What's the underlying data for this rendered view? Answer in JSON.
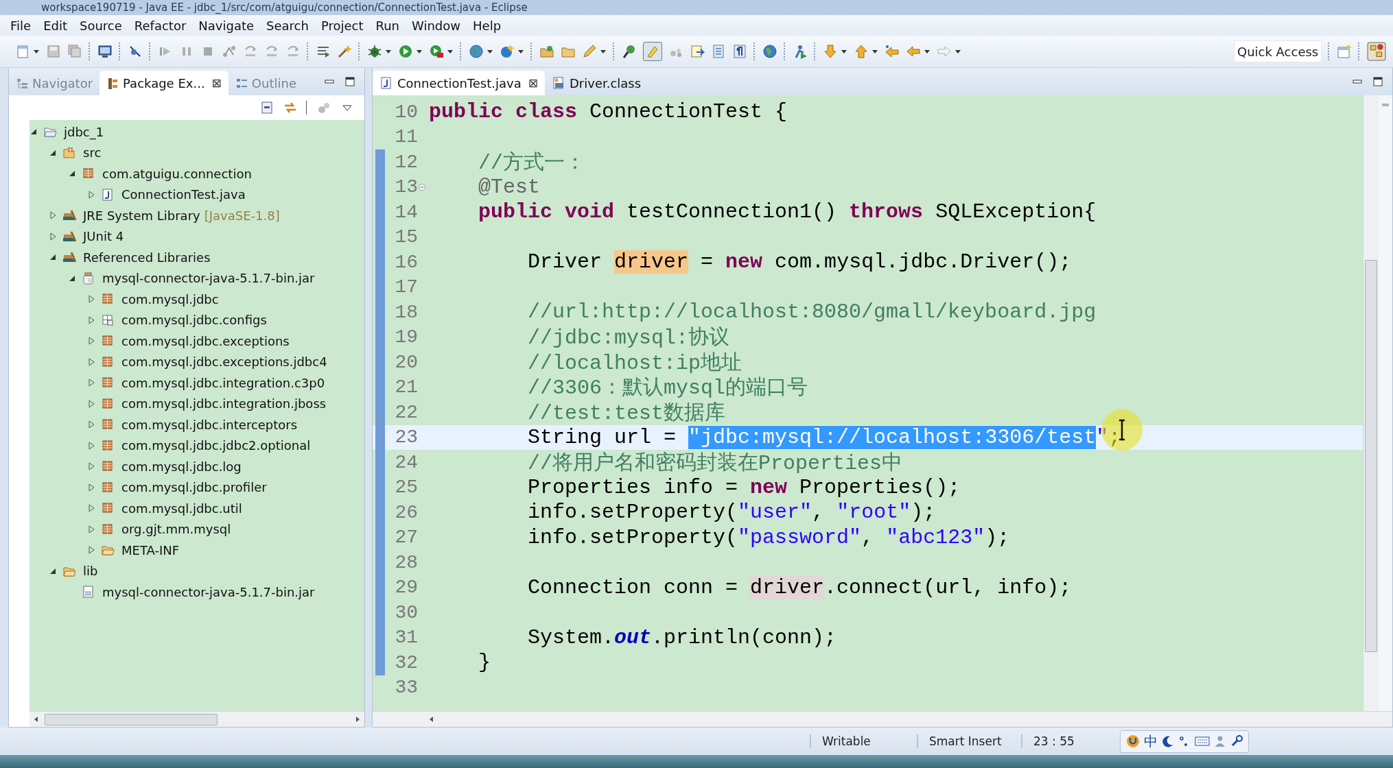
{
  "window": {
    "title": "workspace190719 - Java EE - jdbc_1/src/com/atguigu/connection/ConnectionTest.java - Eclipse"
  },
  "menu": [
    "File",
    "Edit",
    "Source",
    "Refactor",
    "Navigate",
    "Search",
    "Project",
    "Run",
    "Window",
    "Help"
  ],
  "quick_access": {
    "placeholder": "Quick Access"
  },
  "side_tabs": [
    {
      "label": "Navigator",
      "selected": false
    },
    {
      "label": "Package Ex...",
      "selected": true,
      "close": "⊠"
    },
    {
      "label": "Outline",
      "selected": false
    }
  ],
  "tree": [
    {
      "kind": "project",
      "label": "jdbc_1",
      "expanded": true,
      "children": [
        {
          "kind": "source-folder",
          "label": "src",
          "expanded": true,
          "children": [
            {
              "kind": "package",
              "label": "com.atguigu.connection",
              "expanded": true,
              "children": [
                {
                  "kind": "java-file",
                  "label": "ConnectionTest.java",
                  "expanded": false
                }
              ]
            }
          ]
        },
        {
          "kind": "library",
          "label": "JRE System Library",
          "decoration": "[JavaSE-1.8]",
          "expanded": false
        },
        {
          "kind": "library",
          "label": "JUnit 4",
          "expanded": false
        },
        {
          "kind": "library",
          "label": "Referenced Libraries",
          "expanded": true,
          "children": [
            {
              "kind": "jar",
              "label": "mysql-connector-java-5.1.7-bin.jar",
              "expanded": true,
              "children": [
                {
                  "kind": "package",
                  "label": "com.mysql.jdbc",
                  "expanded": false
                },
                {
                  "kind": "resource-package",
                  "label": "com.mysql.jdbc.configs",
                  "expanded": false
                },
                {
                  "kind": "package",
                  "label": "com.mysql.jdbc.exceptions",
                  "expanded": false
                },
                {
                  "kind": "package",
                  "label": "com.mysql.jdbc.exceptions.jdbc4",
                  "expanded": false
                },
                {
                  "kind": "package",
                  "label": "com.mysql.jdbc.integration.c3p0",
                  "expanded": false
                },
                {
                  "kind": "package",
                  "label": "com.mysql.jdbc.integration.jboss",
                  "expanded": false
                },
                {
                  "kind": "package",
                  "label": "com.mysql.jdbc.interceptors",
                  "expanded": false
                },
                {
                  "kind": "package",
                  "label": "com.mysql.jdbc.jdbc2.optional",
                  "expanded": false
                },
                {
                  "kind": "package",
                  "label": "com.mysql.jdbc.log",
                  "expanded": false
                },
                {
                  "kind": "package",
                  "label": "com.mysql.jdbc.profiler",
                  "expanded": false
                },
                {
                  "kind": "package",
                  "label": "com.mysql.jdbc.util",
                  "expanded": false
                },
                {
                  "kind": "package",
                  "label": "org.gjt.mm.mysql",
                  "expanded": false
                },
                {
                  "kind": "folder",
                  "label": "META-INF",
                  "expanded": false
                }
              ]
            }
          ]
        },
        {
          "kind": "folder",
          "label": "lib",
          "expanded": true,
          "children": [
            {
              "kind": "jar-file",
              "label": "mysql-connector-java-5.1.7-bin.jar"
            }
          ]
        }
      ]
    }
  ],
  "editor_tabs": [
    {
      "kind": "java",
      "label": "ConnectionTest.java",
      "selected": true,
      "close": "⊠"
    },
    {
      "kind": "class",
      "label": "Driver.class",
      "selected": false
    }
  ],
  "code": [
    {
      "number": "10",
      "changed": false,
      "current": false,
      "fold": false,
      "kind": "class",
      "segments": [
        {
          "kind": "keyword",
          "text": "public class"
        },
        {
          "kind": "plain",
          "text": " ConnectionTest {"
        }
      ]
    },
    {
      "number": "11",
      "changed": false,
      "current": false,
      "fold": false
    },
    {
      "number": "12",
      "changed": true,
      "current": false,
      "fold": false,
      "kind": "member",
      "segments": [
        {
          "kind": "comment",
          "text": "//方式一："
        }
      ]
    },
    {
      "number": "13",
      "changed": true,
      "current": false,
      "fold": true,
      "kind": "member",
      "segments": [
        {
          "kind": "annotation",
          "text": "@Test"
        }
      ]
    },
    {
      "number": "14",
      "changed": true,
      "current": false,
      "fold": false,
      "kind": "member",
      "segments": [
        {
          "kind": "keyword",
          "text": "public void"
        },
        {
          "kind": "plain",
          "text": " testConnection1() "
        },
        {
          "kind": "keyword",
          "text": "throws"
        },
        {
          "kind": "plain",
          "text": " SQLException{"
        }
      ]
    },
    {
      "number": "15",
      "changed": true,
      "current": false,
      "fold": false
    },
    {
      "number": "16",
      "changed": true,
      "current": false,
      "fold": false,
      "kind": "statement",
      "segments": [
        {
          "kind": "plain",
          "text": "Driver "
        },
        {
          "kind": "write-occurrence",
          "text": "driver"
        },
        {
          "kind": "plain",
          "text": " = "
        },
        {
          "kind": "keyword",
          "text": "new"
        },
        {
          "kind": "plain",
          "text": " com.mysql.jdbc.Driver();"
        }
      ]
    },
    {
      "number": "17",
      "changed": true,
      "current": false,
      "fold": false
    },
    {
      "number": "18",
      "changed": true,
      "current": false,
      "fold": false,
      "kind": "statement",
      "segments": [
        {
          "kind": "comment",
          "text": "//url:http://localhost:8080/gmall/keyboard.jpg"
        }
      ]
    },
    {
      "number": "19",
      "changed": true,
      "current": false,
      "fold": false,
      "kind": "statement",
      "segments": [
        {
          "kind": "comment",
          "text": "//jdbc:mysql:协议"
        }
      ]
    },
    {
      "number": "20",
      "changed": true,
      "current": false,
      "fold": false,
      "kind": "statement",
      "segments": [
        {
          "kind": "comment",
          "text": "//localhost:ip地址"
        }
      ]
    },
    {
      "number": "21",
      "changed": true,
      "current": false,
      "fold": false,
      "kind": "statement",
      "segments": [
        {
          "kind": "comment",
          "text": "//3306：默认mysql的端口号"
        }
      ]
    },
    {
      "number": "22",
      "changed": true,
      "current": false,
      "fold": false,
      "kind": "statement",
      "segments": [
        {
          "kind": "comment",
          "text": "//test:test数据库"
        }
      ]
    },
    {
      "number": "23",
      "changed": true,
      "current": true,
      "fold": false,
      "kind": "statement",
      "segments": [
        {
          "kind": "plain",
          "text": "String url = "
        },
        {
          "kind": "selected-string",
          "text": "\"jdbc:mysql://localhost:3306/test"
        },
        {
          "kind": "string",
          "text": "\""
        },
        {
          "kind": "plain",
          "text": ";"
        }
      ]
    },
    {
      "number": "24",
      "changed": true,
      "current": false,
      "fold": false,
      "kind": "statement",
      "segments": [
        {
          "kind": "comment",
          "text": "//将用户名和密码封装在Properties中"
        }
      ]
    },
    {
      "number": "25",
      "changed": true,
      "current": false,
      "fold": false,
      "kind": "statement",
      "segments": [
        {
          "kind": "plain",
          "text": "Properties info = "
        },
        {
          "kind": "keyword",
          "text": "new"
        },
        {
          "kind": "plain",
          "text": " Properties();"
        }
      ]
    },
    {
      "number": "26",
      "changed": true,
      "current": false,
      "fold": false,
      "kind": "statement",
      "segments": [
        {
          "kind": "plain",
          "text": "info.setProperty("
        },
        {
          "kind": "string",
          "text": "\"user\""
        },
        {
          "kind": "plain",
          "text": ", "
        },
        {
          "kind": "string",
          "text": "\"root\""
        },
        {
          "kind": "plain",
          "text": ");"
        }
      ]
    },
    {
      "number": "27",
      "changed": true,
      "current": false,
      "fold": false,
      "kind": "statement",
      "segments": [
        {
          "kind": "plain",
          "text": "info.setProperty("
        },
        {
          "kind": "string",
          "text": "\"password\""
        },
        {
          "kind": "plain",
          "text": ", "
        },
        {
          "kind": "string",
          "text": "\"abc123\""
        },
        {
          "kind": "plain",
          "text": ");"
        }
      ]
    },
    {
      "number": "28",
      "changed": true,
      "current": false,
      "fold": false
    },
    {
      "number": "29",
      "changed": true,
      "current": false,
      "fold": false,
      "kind": "statement",
      "segments": [
        {
          "kind": "plain",
          "text": "Connection conn = "
        },
        {
          "kind": "read-occurrence",
          "text": "driver"
        },
        {
          "kind": "plain",
          "text": ".connect(url, info);"
        }
      ]
    },
    {
      "number": "30",
      "changed": true,
      "current": false,
      "fold": false
    },
    {
      "number": "31",
      "changed": true,
      "current": false,
      "fold": false,
      "kind": "statement",
      "segments": [
        {
          "kind": "plain",
          "text": "System."
        },
        {
          "kind": "static-field",
          "text": "out"
        },
        {
          "kind": "plain",
          "text": ".println(conn);"
        }
      ]
    },
    {
      "number": "32",
      "changed": true,
      "current": false,
      "fold": false,
      "kind": "member",
      "segments": [
        {
          "kind": "plain",
          "text": "}"
        }
      ]
    },
    {
      "number": "33",
      "changed": false,
      "current": false,
      "fold": false
    }
  ],
  "status_bar": {
    "mode": "Writable",
    "insert": "Smart Insert",
    "position": "23 : 55"
  },
  "ime_bar": {
    "label": "中"
  }
}
